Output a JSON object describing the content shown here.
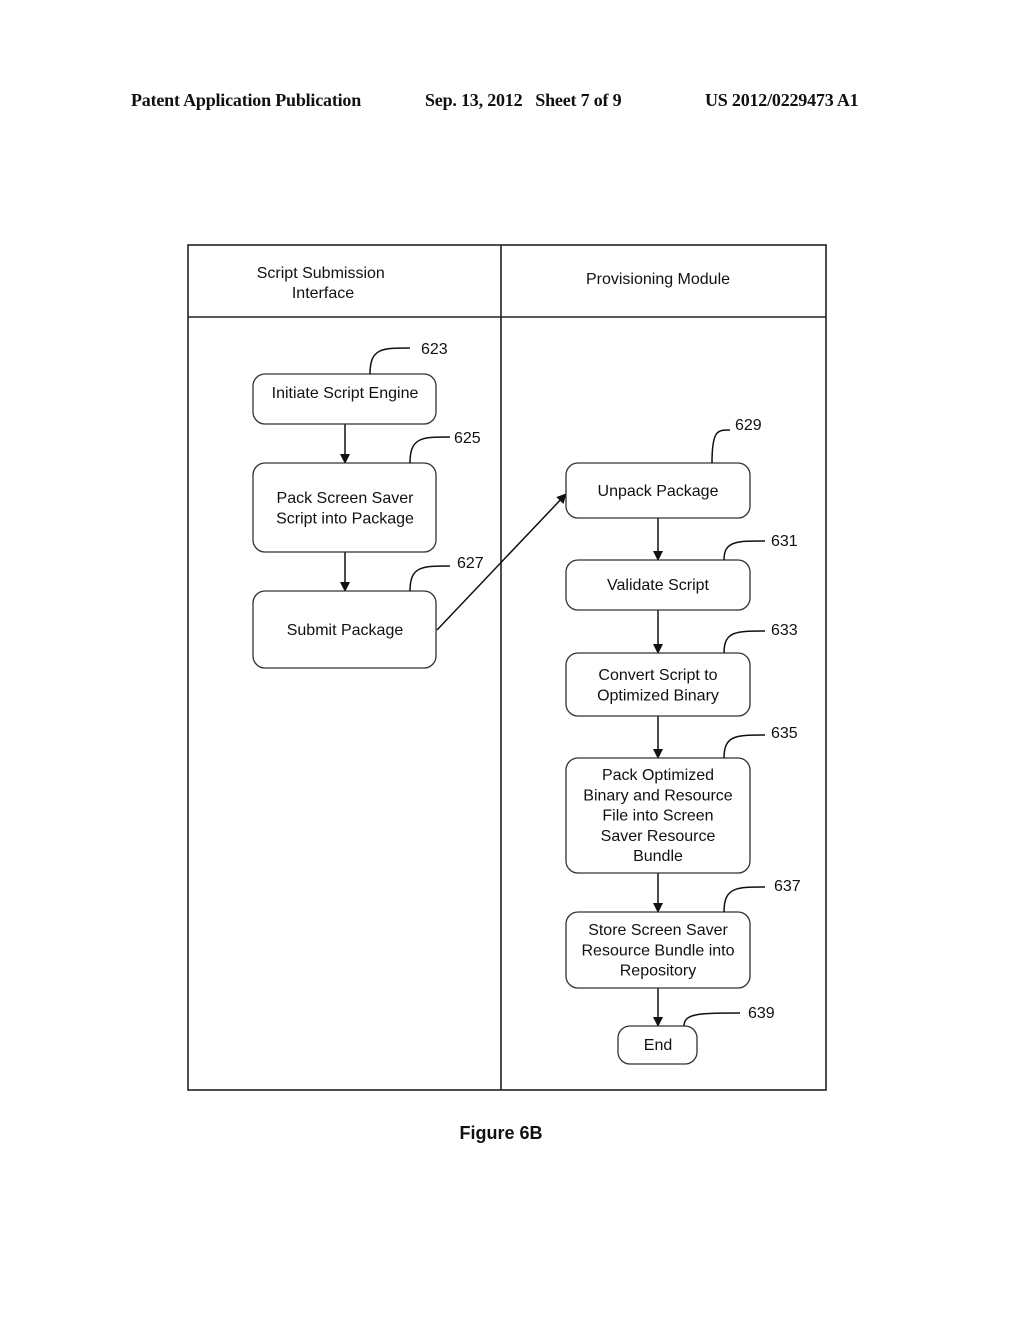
{
  "header": {
    "publication": "Patent Application Publication",
    "date_sheet": "Sep. 13, 2012   Sheet 7 of 9",
    "number": "US 2012/0229473 A1"
  },
  "lanes": [
    {
      "title_lines": [
        "Script Submission",
        "Interface"
      ]
    },
    {
      "title_lines": [
        "Provisioning Module"
      ]
    }
  ],
  "steps": [
    {
      "ref": "623",
      "lines": [
        "Initiate Script Engine"
      ]
    },
    {
      "ref": "625",
      "lines": [
        "Pack Screen Saver",
        "Script into Package"
      ]
    },
    {
      "ref": "627",
      "lines": [
        "Submit Package"
      ]
    },
    {
      "ref": "629",
      "lines": [
        "Unpack Package"
      ]
    },
    {
      "ref": "631",
      "lines": [
        "Validate Script"
      ]
    },
    {
      "ref": "633",
      "lines": [
        "Convert Script to",
        "Optimized Binary"
      ]
    },
    {
      "ref": "635",
      "lines": [
        "Pack Optimized",
        "Binary and Resource",
        "File into Screen",
        "Saver Resource",
        "Bundle"
      ]
    },
    {
      "ref": "637",
      "lines": [
        "Store Screen Saver",
        "Resource Bundle into",
        "Repository"
      ]
    },
    {
      "ref": "639",
      "lines": [
        "End"
      ]
    }
  ],
  "figure_caption": "Figure 6B"
}
